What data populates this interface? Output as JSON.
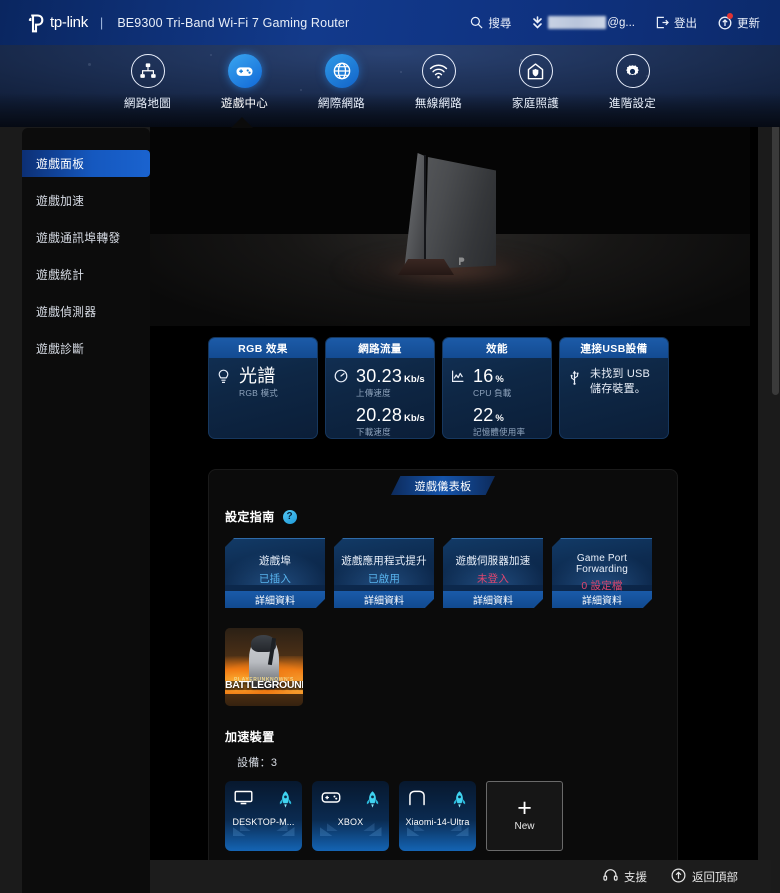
{
  "header": {
    "brand": "tp-link",
    "separator": "|",
    "model": "BE9300 Tri-Band Wi-Fi 7 Gaming Router",
    "search_label": "搜尋",
    "search_icon": "search-icon",
    "account_mask": "",
    "account_suffix": "@g...",
    "account_icon": "chevron-down-icon",
    "logout_label": "登出",
    "logout_icon": "logout-icon",
    "update_label": "更新",
    "update_icon": "update-icon",
    "update_badge": true
  },
  "nav": {
    "items": [
      {
        "label": "網路地圖",
        "icon": "network-map-icon",
        "active": false
      },
      {
        "label": "遊戲中心",
        "icon": "gamepad-icon",
        "active": true
      },
      {
        "label": "網際網路",
        "icon": "globe-icon",
        "active": false
      },
      {
        "label": "無線網路",
        "icon": "wifi-icon",
        "active": false
      },
      {
        "label": "家庭照護",
        "icon": "home-shield-icon",
        "active": false
      },
      {
        "label": "進階設定",
        "icon": "gear-icon",
        "active": false
      }
    ]
  },
  "sidebar": {
    "items": [
      {
        "label": "遊戲面板",
        "active": true
      },
      {
        "label": "遊戲加速",
        "active": false
      },
      {
        "label": "遊戲通訊埠轉發",
        "active": false
      },
      {
        "label": "遊戲統計",
        "active": false
      },
      {
        "label": "遊戲偵測器",
        "active": false
      },
      {
        "label": "遊戲診斷",
        "active": false
      }
    ]
  },
  "status_cards": [
    {
      "title": "RGB 效果",
      "icon": "bulb-icon",
      "value": "光譜",
      "caption": "RGB 模式",
      "kind": "single"
    },
    {
      "title": "網路流量",
      "icon": "speedometer-icon",
      "kind": "dual",
      "primary_value": "30.23",
      "primary_unit": "Kb/s",
      "primary_caption": "上傳速度",
      "secondary_value": "20.28",
      "secondary_unit": "Kb/s",
      "secondary_caption": "下載速度"
    },
    {
      "title": "效能",
      "icon": "chart-icon",
      "kind": "dual",
      "primary_value": "16",
      "primary_unit": "%",
      "primary_caption": "CPU 負載",
      "secondary_value": "22",
      "secondary_unit": "%",
      "secondary_caption": "記憶體使用率"
    },
    {
      "title": "連接USB設備",
      "icon": "usb-icon",
      "kind": "text",
      "text": "未找到 USB 儲存裝置。"
    }
  ],
  "dashboard": {
    "tab_label": "遊戲儀表板",
    "guide_title": "設定指南",
    "help_icon": "help-icon",
    "help_glyph": "?",
    "guide_cards": [
      {
        "name": "遊戲埠",
        "state": "已插入",
        "state_color": "#58b4ee",
        "detail": "詳細資料",
        "is_english": false
      },
      {
        "name": "遊戲應用程式提升",
        "state": "已啟用",
        "state_color": "#58b4ee",
        "detail": "詳細資料",
        "is_english": false
      },
      {
        "name": "遊戲伺服器加速",
        "state": "未登入",
        "state_color": "#e0466f",
        "detail": "詳細資料",
        "is_english": false
      },
      {
        "name": "Game Port Forwarding",
        "state": "0 設定檔",
        "state_color": "#e0466f",
        "detail": "詳細資料",
        "is_english": true
      }
    ],
    "game_thumbnail": {
      "name": "playerunknowns-battlegrounds-thumbnail",
      "subtitle": "PLAYERUNKNOWN'S",
      "title": "BATTLEGROUNDS"
    },
    "accelerated_title": "加速裝置",
    "device_count_label": "設備：3",
    "devices": [
      {
        "label": "DESKTOP-M...",
        "icon": "monitor-icon",
        "boost_icon": "rocket-icon"
      },
      {
        "label": "XBOX",
        "icon": "gamepad-icon",
        "boost_icon": "rocket-icon"
      },
      {
        "label": "Xiaomi-14-Ultra",
        "icon": "phone-icon",
        "boost_icon": "rocket-icon"
      }
    ],
    "add_device": {
      "label": "New",
      "icon": "plus-icon",
      "glyph": "+"
    }
  },
  "footer": {
    "support_label": "支援",
    "support_icon": "headset-icon",
    "top_label": "返回頂部",
    "top_icon": "arrow-up-circle-icon"
  },
  "colors": {
    "accent": "#1a63cf",
    "header_blue": "#123a8c",
    "alert_red": "#e0466f",
    "info_blue": "#58b4ee"
  }
}
